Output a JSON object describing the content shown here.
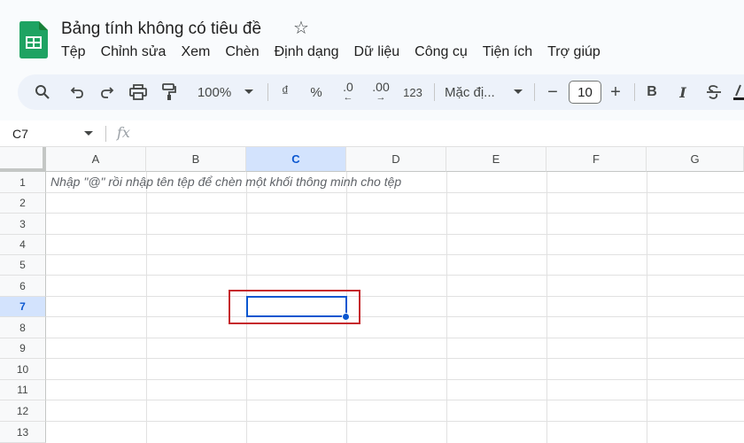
{
  "document": {
    "title": "Bảng tính không có tiêu đề"
  },
  "menu": [
    "Tệp",
    "Chỉnh sửa",
    "Xem",
    "Chèn",
    "Định dạng",
    "Dữ liệu",
    "Công cụ",
    "Tiện ích",
    "Trợ giúp"
  ],
  "toolbar": {
    "zoom": "100%",
    "currency": "₫",
    "percent": "%",
    "decrease_decimal": ".0",
    "increase_decimal": ".00",
    "number_format": "123",
    "font": "Mặc đị...",
    "font_size": "10",
    "minus": "−",
    "plus": "+",
    "bold": "B",
    "italic": "I"
  },
  "formula_bar": {
    "name_box": "C7",
    "fx": "fx"
  },
  "grid": {
    "columns": [
      "A",
      "B",
      "C",
      "D",
      "E",
      "F",
      "G"
    ],
    "rows": [
      "1",
      "2",
      "3",
      "4",
      "5",
      "6",
      "7",
      "8",
      "9",
      "10",
      "11",
      "12",
      "13"
    ],
    "active_column": "C",
    "active_row": "7",
    "hint_text": "Nhập \"@\" rồi nhập tên tệp để chèn một khối thông minh cho tệp"
  },
  "colors": {
    "accent": "#0b57d0",
    "highlight": "#c5282c",
    "sheets_green": "#0f9d58"
  }
}
